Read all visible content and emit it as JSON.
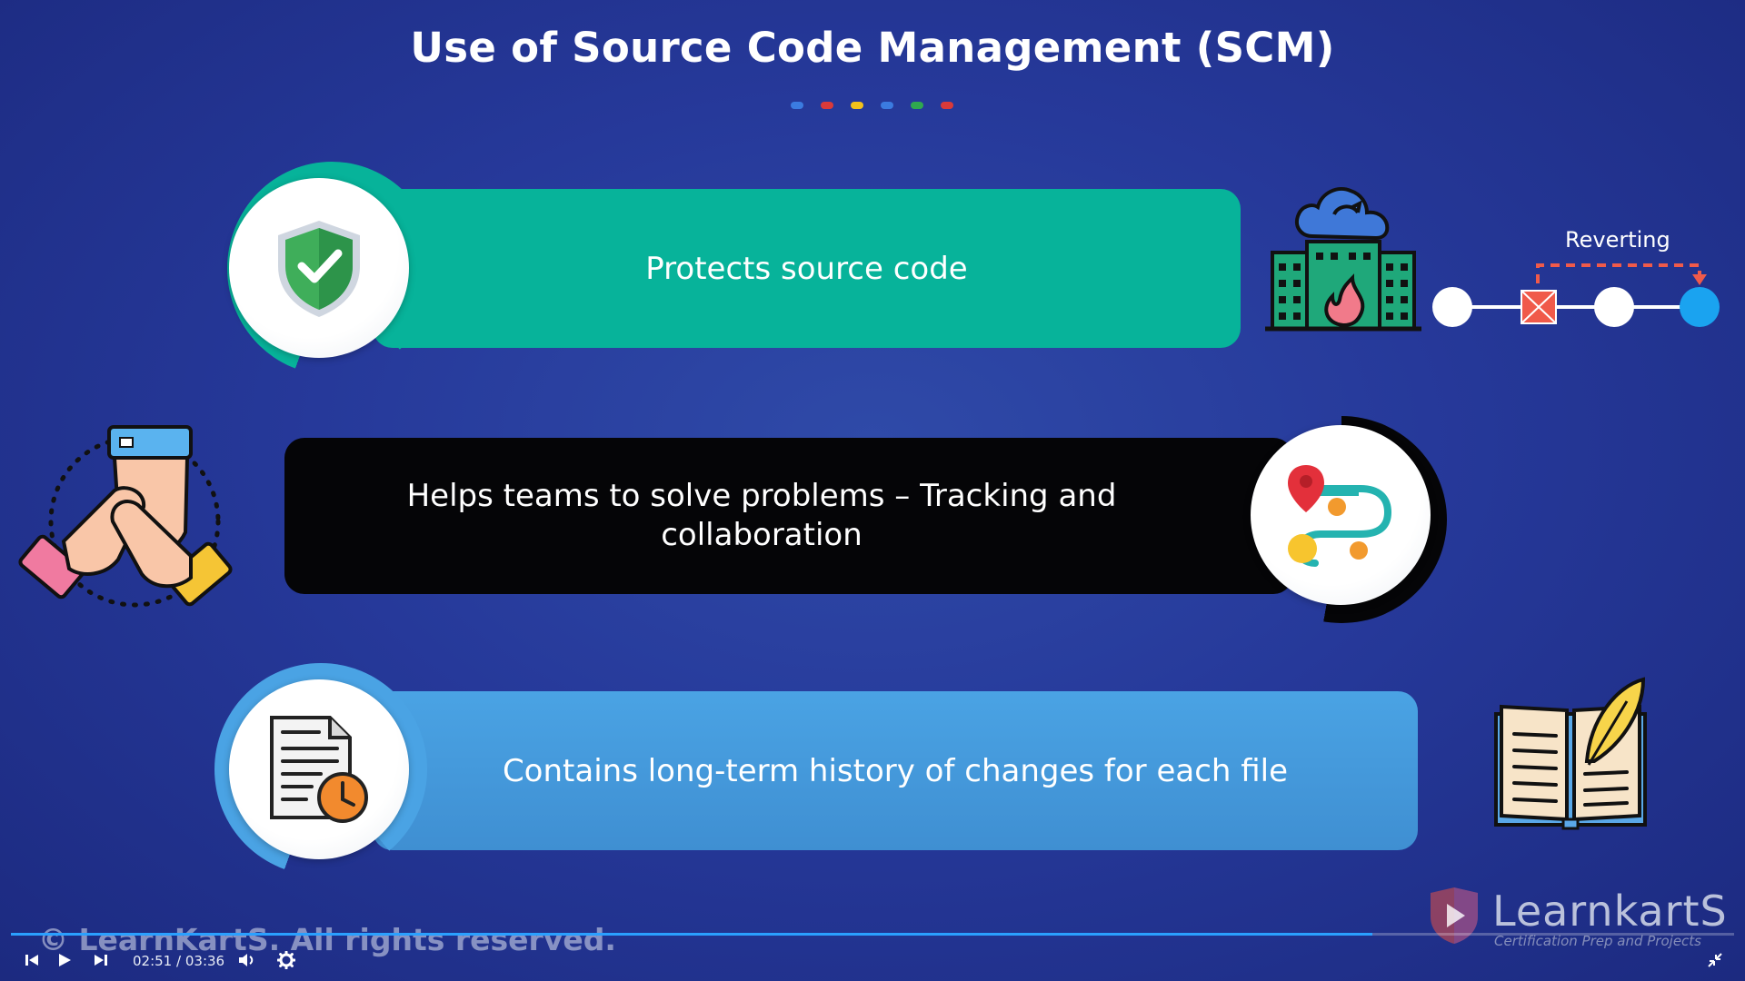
{
  "slide": {
    "title": "Use of Source Code Management (SCM)",
    "accent_dots": [
      "#3b7be0",
      "#d93a3a",
      "#f2c21b",
      "#3b7be0",
      "#2fa84f",
      "#d93a3a"
    ]
  },
  "points": [
    {
      "text": "Protects source code",
      "color": "#07b39a",
      "icon": "shield-check-icon"
    },
    {
      "text": "Helps teams to solve problems – Tracking and collaboration",
      "color": "#050507",
      "icon": "route-path-icon"
    },
    {
      "text": "Contains long-term history of changes for each file",
      "color": "#4aa3e4",
      "icon": "document-clock-icon"
    }
  ],
  "side_graphics": {
    "building_icon": "cloud-building-fire-icon",
    "reverting_label": "Reverting",
    "hands_icon": "teamwork-hands-icon",
    "book_icon": "book-quill-icon"
  },
  "watermark": "© LearnKartS. All rights reserved.",
  "brand": {
    "name": "LearnkartS",
    "tagline": "Certification Prep and Projects"
  },
  "player": {
    "current_time": "02:51",
    "separator": "/",
    "duration": "03:36",
    "progress": 0.79
  }
}
